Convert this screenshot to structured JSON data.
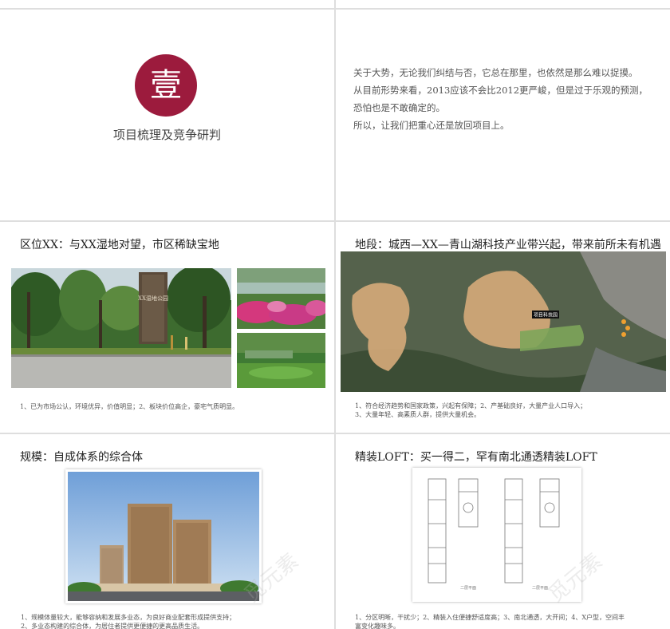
{
  "sections": {
    "numeral": "壹",
    "title": "项目梳理及竞争研判"
  },
  "intro": {
    "lines": [
      "关于大势，无论我们纠结与否，它总在那里，也依然是那么难以捉摸。",
      "从目前形势来看，2013应该不会比2012更严峻，但是过于乐观的预测，恐怕也是不敢确定的。",
      "所以，让我们把重心还是放回项目上。"
    ]
  },
  "location": {
    "title": "区位XX：与XX湿地对望，市区稀缺宝地",
    "sign_text": "XX湿地公园",
    "caption": "1、已为市场公认，环境优异，价值明显；2、板块价位高企，豪宅气质明显。"
  },
  "plot": {
    "title": "地段：城西—XX—青山湖科技产业带兴起，带来前所未有机遇",
    "map_label": "项目科技园",
    "caption_lines": [
      "1、符合经济趋势和国家政策，兴起有保障；2、产基础良好，大量产业人口导入；",
      "3、大量年轻、高素质人群，提供大量机会。"
    ]
  },
  "scale": {
    "title": "规模：自成体系的综合体",
    "caption_lines": [
      "1、规模体量较大，能够容纳和发展多业态，为良好商业配套形成提供支持；",
      "2、多业态构建的综合体，为居住者提供更便捷的更高品质生活。"
    ]
  },
  "loft": {
    "title": "精装LOFT：买一得二，罕有南北通透精装LOFT",
    "plan_label_1": "二层平面",
    "plan_label_2": "二层平面",
    "caption_lines": [
      "1、分区明晰，干扰少；2、精装入住便捷舒适度高；3、南北通透，大开间；4、X户型，空间丰",
      "富变化趣味多。"
    ]
  },
  "watermark": "觅元素",
  "colors": {
    "accent": "#9c1b3d",
    "background": "#dedede"
  }
}
